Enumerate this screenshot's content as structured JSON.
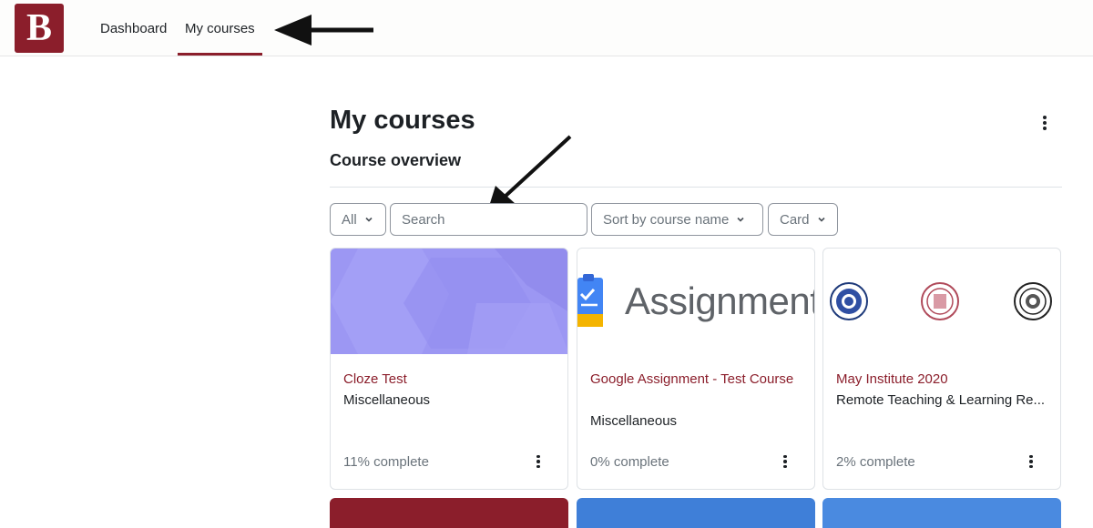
{
  "navbar": {
    "logo_letter": "B",
    "items": [
      {
        "label": "Dashboard"
      },
      {
        "label": "My courses"
      }
    ]
  },
  "main": {
    "title": "My courses",
    "section_title": "Course overview",
    "filters": {
      "grouping": "All",
      "search_placeholder": "Search",
      "sort": "Sort by course name",
      "view": "Card"
    }
  },
  "courses": [
    {
      "name": "Cloze Test",
      "category": "Miscellaneous",
      "progress": "11% complete",
      "image": "purple-geometric-pattern"
    },
    {
      "name": "Google Assignment - Test Course",
      "category": "Miscellaneous",
      "progress": "0% complete",
      "image": "google-assignment-logo",
      "image_text": "Assignment"
    },
    {
      "name": "May Institute 2020",
      "category": "Remote Teaching & Learning Re...",
      "progress": "2% complete",
      "image": "university-seals"
    }
  ],
  "colors": {
    "brand": "#8b1e2b",
    "card_purple": "#9c97f3",
    "text": "#1d2125",
    "muted": "#6a737b"
  },
  "icons": [
    "kebab-menu-icon",
    "chevron-down-icon",
    "annotation-arrow"
  ]
}
